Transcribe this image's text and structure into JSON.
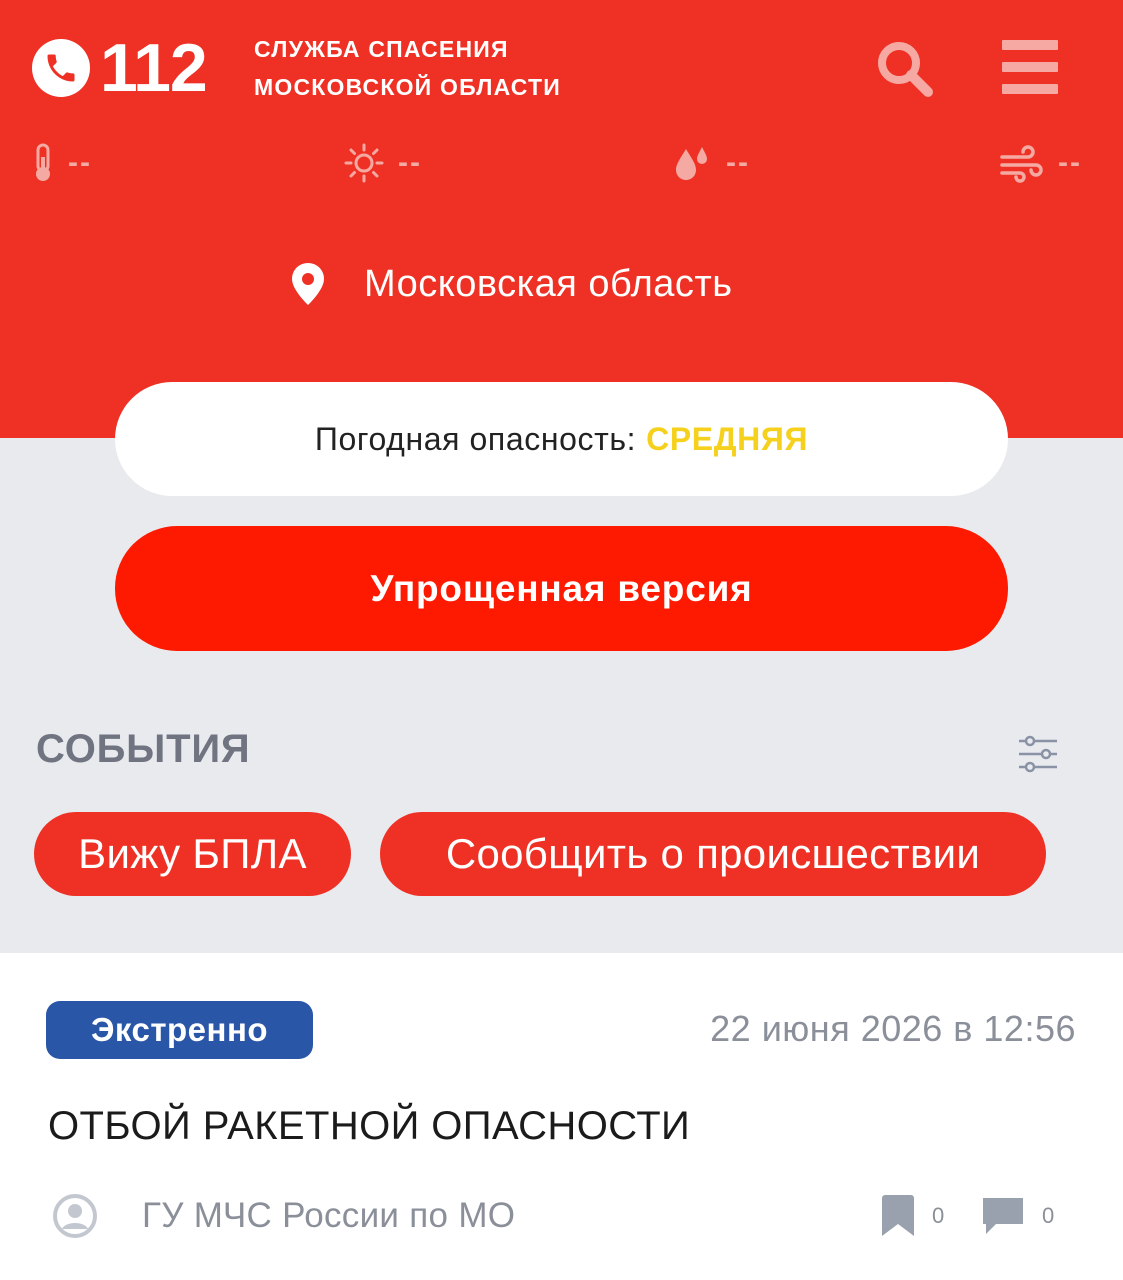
{
  "header": {
    "logo_number": "112",
    "service_line1": "СЛУЖБА СПАСЕНИЯ",
    "service_line2": "МОСКОВСКОЙ ОБЛАСТИ"
  },
  "weather": {
    "temperature": "--",
    "uv": "--",
    "humidity": "--",
    "wind": "--"
  },
  "location": "Московская область",
  "hazard": {
    "label": "Погодная опасность:",
    "level": "СРЕДНЯЯ"
  },
  "simple_version_label": "Упрощенная версия",
  "events": {
    "title": "СОБЫТИЯ",
    "chips": [
      "Вижу БПЛА",
      "Сообщить о происшествии"
    ]
  },
  "event_item": {
    "badge": "Экстренно",
    "date": "22 июня 2026 в 12:56",
    "title": "ОТБОЙ РАКЕТНОЙ ОПАСНОСТИ",
    "author": "ГУ МЧС России по МО",
    "bookmarks": "0",
    "comments": "0"
  },
  "colors": {
    "header_red": "#ee3124",
    "button_red": "#fe1a00",
    "hazard_yellow": "#f5d11d",
    "badge_blue": "#2a56a8",
    "background_grey": "#e9eaee"
  }
}
